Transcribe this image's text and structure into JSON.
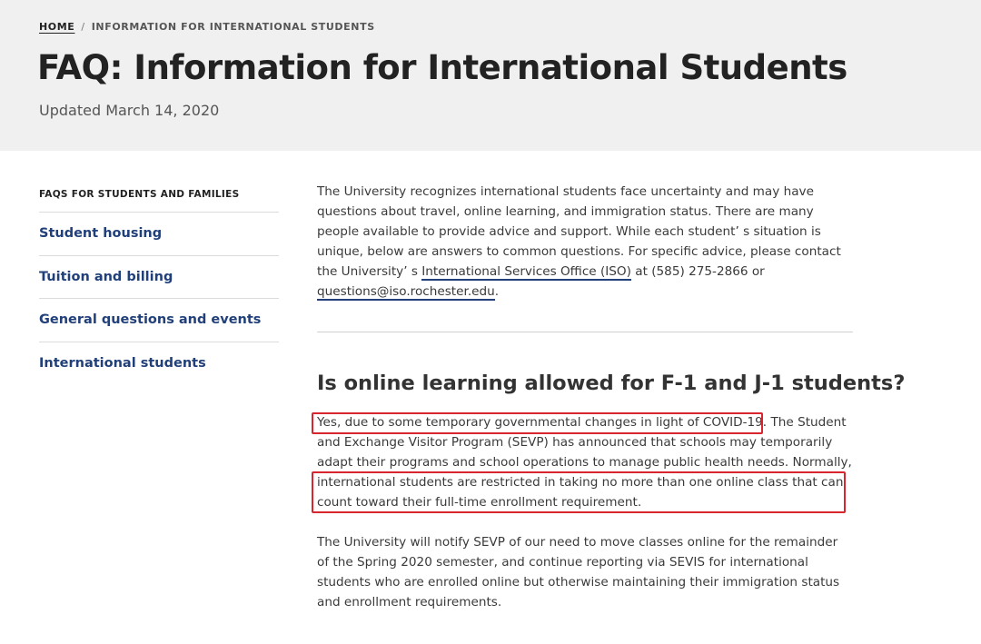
{
  "breadcrumb": {
    "home": "HOME",
    "separator": "/",
    "current": "INFORMATION FOR INTERNATIONAL STUDENTS"
  },
  "page": {
    "title": "FAQ: Information for International Students",
    "updated": "Updated March 14, 2020"
  },
  "sidebar": {
    "heading": "FAQS FOR STUDENTS AND FAMILIES",
    "items": [
      {
        "label": "Student housing"
      },
      {
        "label": "Tuition and billing"
      },
      {
        "label": "General questions and events"
      },
      {
        "label": "International students"
      }
    ]
  },
  "intro": {
    "text_before": "The University recognizes international students face uncertainty and may have questions about travel, online learning, and immigration status. There are many people available to provide advice and support. While each student’ s situation is unique, below are answers to common questions. For specific advice, please contact the University’ s ",
    "iso_link": "International Services Office (ISO)",
    "text_middle": " at (585) 275-2866 or ",
    "email_link": "questions@iso.rochester.edu",
    "text_after": "."
  },
  "faq": {
    "question": "Is online learning allowed for F-1 and J-1 students?",
    "answer_highlight_1": "Yes, due to some temporary governmental changes in light of COVID-19.",
    "answer_middle": " The Student and Exchange Visitor Program (SEVP) has announced that schools may temporarily adapt their programs and school operations to manage public health needs. Normally, ",
    "answer_highlight_2": "international students are restricted in taking no more than one online class that can count toward their full-time enrollment requirement.",
    "answer_para_2": "The University will notify SEVP of our need to move classes online for the remainder of the Spring 2020 semester, and continue reporting via SEVIS for international students who are enrolled online but otherwise maintaining their immigration status and enrollment requirements."
  },
  "colors": {
    "link": "#21407a",
    "highlight_box": "#d9252d",
    "hero_background": "#f0f0f0"
  }
}
